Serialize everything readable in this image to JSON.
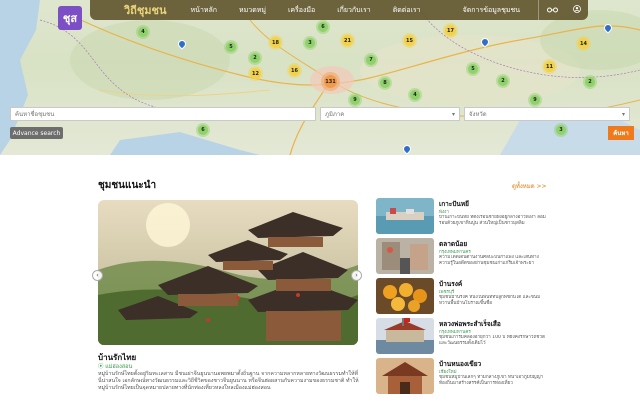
{
  "nav": {
    "logo": "ชุส",
    "brand": "วิถีชุมชน",
    "links": [
      "หน้าหลัก",
      "หมวดหมู่",
      "เครื่องมือ",
      "เกี่ยวกับเรา",
      "ติดต่อเรา"
    ],
    "manage": "จัดการข้อมูลชุมชน",
    "icons": [
      "glasses-icon",
      "user-icon"
    ]
  },
  "search": {
    "keyword_placeholder": "ค้นหาชื่อชุมชน",
    "region_placeholder": "ภูมิภาค",
    "province_placeholder": "จังหวัด",
    "advanced_label": "Advance search",
    "button_label": "ค้นหา"
  },
  "map": {
    "clusters": [
      {
        "label": "4",
        "color": "green"
      },
      {
        "label": "5",
        "color": "green"
      },
      {
        "label": "18",
        "color": "yellow"
      },
      {
        "label": "2",
        "color": "green"
      },
      {
        "label": "16",
        "color": "yellow"
      },
      {
        "label": "12",
        "color": "yellow"
      },
      {
        "label": "6",
        "color": "green"
      },
      {
        "label": "3",
        "color": "green"
      },
      {
        "label": "131",
        "color": "orange"
      },
      {
        "label": "21",
        "color": "yellow"
      },
      {
        "label": "7",
        "color": "green"
      },
      {
        "label": "8",
        "color": "green"
      },
      {
        "label": "15",
        "color": "yellow"
      },
      {
        "label": "9",
        "color": "green"
      },
      {
        "label": "4",
        "color": "green"
      },
      {
        "label": "17",
        "color": "yellow"
      },
      {
        "label": "5",
        "color": "green"
      },
      {
        "label": "2",
        "color": "green"
      },
      {
        "label": "11",
        "color": "yellow"
      },
      {
        "label": "3",
        "color": "green"
      },
      {
        "label": "6",
        "color": "green"
      },
      {
        "label": "14",
        "color": "yellow"
      },
      {
        "label": "2",
        "color": "green"
      },
      {
        "label": "9",
        "color": "green"
      }
    ]
  },
  "recommended": {
    "title": "ชุมชนแนะนำ",
    "see_all": "ดูทั้งหมด >>",
    "featured": {
      "title": "บ้านรักไทย",
      "province": "แม่ฮ่องสอน",
      "description": "หมู่บ้านรักษ์ไทยตั้งอยู่ริมทะเลสาบ มีชนเผ่าจีนยูนนานอพยพมาตั้งถิ่นฐาน จากความหลากหลายทางวัฒนธรรมทำให้ที่นี่น่าสนใจ เอกลักษณ์ทางวัฒนธรรมและวิถีชีวิตของชาวจีนยูนนาน หรือจีนฮ่อผสานกับความงามของธรรมชาติ ทำให้หมู่บ้านรักษ์ไทยเป็นจุดหมายปลายทางที่นักท่องเที่ยวหลงใหลเมืองแม่ฮ่องสอน"
    },
    "items": [
      {
        "title": "เกาะปันหยี",
        "province": "พังงา",
        "description": "บ้านเกาะปันหยี ที่ตั้งเรือนชายฝั่งอยู่กลางอ่าวพังงา ล้อมรอบด้วยภูเขาหินปูน ส่วนใหญ่เป็นชาวมุสลิม"
      },
      {
        "title": "ตลาดน้อย",
        "province": "กรุงเทพมหานคร",
        "description": "ความโดดเด่นด้านงานศิลปะบนกำแพง และเส้นทางความรู้ในอดีตของย่านชุมชนเก่าแก่ริมเจ้าพระยา"
      },
      {
        "title": "บ้านรงค์",
        "province": "เพชรบุรี",
        "description": "ชุมชนบ้านรงค์ หนึ่งในพื้นที่ที่ปลูกพืชกินได้ และขนมหวานพื้นบ้านโบราณขึ้นชื่อ"
      },
      {
        "title": "หลวงพ่อพระสำเร็จเสือ",
        "province": "กรุงเทพมหานคร",
        "description": "ชุมชนเก่าริมคลองอายุกว่า 100 ปี ที่ยังคงรักษาวิถีชีวิตและวัฒนธรรมดั้งเดิมไว้"
      },
      {
        "title": "บ้านหนองเขียว",
        "province": "เชียงใหม่",
        "description": "ชุมชนหมู่บ้านเล็กๆ ท่ามกลางภูเขา ที่นำเอาภูมิปัญญาท้องถิ่นมาสร้างสรรค์เป็นการท่องเที่ยว"
      }
    ]
  },
  "colors": {
    "accent": "#f07a1b",
    "nav_bg": "#5c5028",
    "logo_bg": "#7c4fc4",
    "province_green": "#3a9a4a"
  }
}
